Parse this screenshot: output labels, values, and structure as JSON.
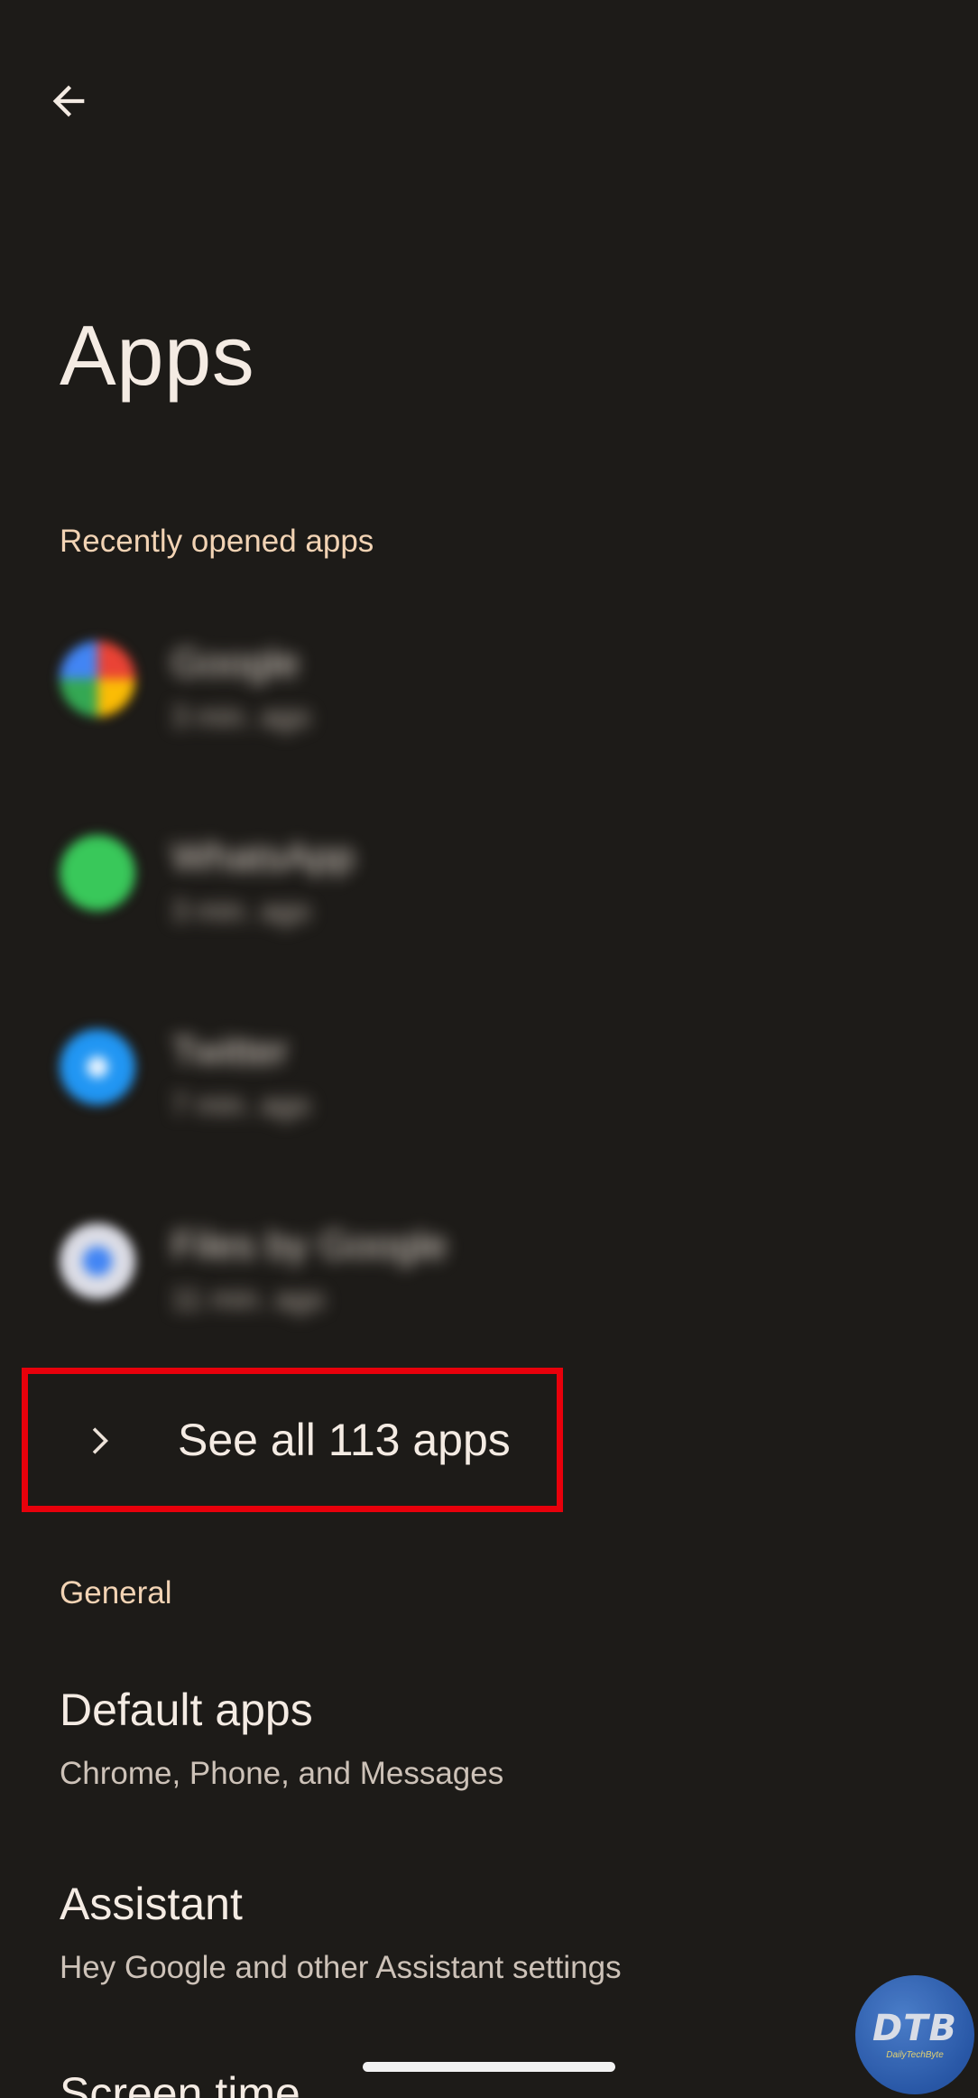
{
  "header": {
    "title": "Apps",
    "back_icon": "arrow-left-icon"
  },
  "recent": {
    "header": "Recently opened apps",
    "apps": [
      {
        "name": "Google",
        "time": "3 min. ago",
        "icon_color": "#e9e2d6"
      },
      {
        "name": "WhatsApp",
        "time": "3 min. ago",
        "icon_color": "#39c85a"
      },
      {
        "name": "Twitter",
        "time": "7 min. ago",
        "icon_color": "#2196f3"
      },
      {
        "name": "Files by Google",
        "time": "11 min. ago",
        "icon_color": "#dcdde6"
      }
    ]
  },
  "see_all": {
    "label": "See all 113 apps",
    "icon": "chevron-right-icon",
    "highlight_color": "#e8000b"
  },
  "general": {
    "header": "General",
    "items": [
      {
        "title": "Default apps",
        "summary": "Chrome, Phone, and Messages"
      },
      {
        "title": "Assistant",
        "summary": "Hey Google and other Assistant settings"
      },
      {
        "title": "Screen time",
        "summary": ""
      }
    ]
  },
  "watermark": {
    "main": "DTB",
    "sub": "DailyTechByte"
  },
  "colors": {
    "background": "#1d1b18",
    "section_header": "#f2d3b4",
    "text_primary": "#f4ebe3",
    "text_secondary": "#cdc2b8"
  }
}
